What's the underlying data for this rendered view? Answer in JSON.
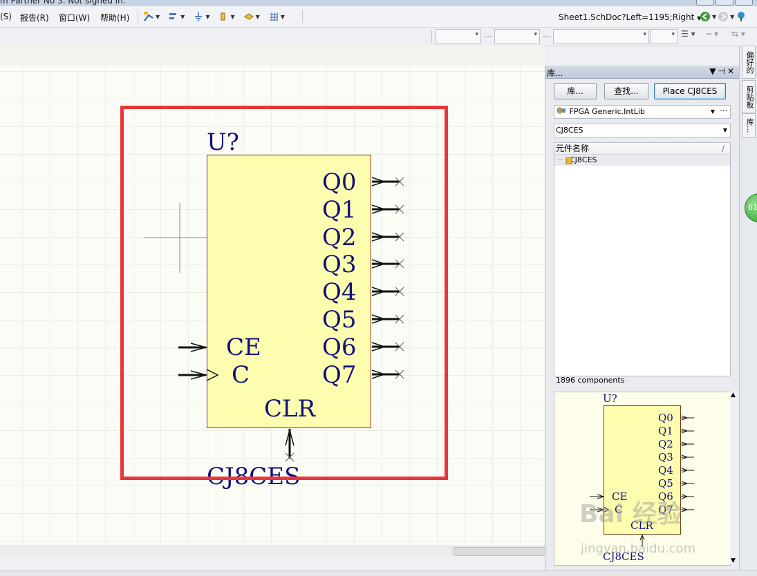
{
  "title_bar": {
    "text": "m Partner No 3. Not signed in."
  },
  "menu": {
    "items": [
      {
        "label": "(S)"
      },
      {
        "label": "报告(R)"
      },
      {
        "label": "窗口(W)"
      },
      {
        "label": "帮助(H)"
      }
    ]
  },
  "toolbar": {
    "document_path": "Sheet1.SchDoc?Left=1195;Right"
  },
  "schematic": {
    "designator": "U?",
    "part_name": "CJ8CES",
    "outputs": [
      "Q0",
      "Q1",
      "Q2",
      "Q3",
      "Q4",
      "Q5",
      "Q6",
      "Q7"
    ],
    "inputs": [
      "CE",
      "C"
    ],
    "bottom_pin": "CLR"
  },
  "library_panel": {
    "title": "库...",
    "buttons": {
      "libraries": "库...",
      "search": "查找...",
      "place": "Place CJ8CES"
    },
    "library_selected": "FPGA Generic.IntLib",
    "filter_value": "CJ8CES",
    "list_header": "元件名称",
    "list_items": [
      "CJ8CES"
    ],
    "component_count": "1896 components"
  },
  "right_tabs": [
    "偏好的",
    "剪贴板",
    "库..."
  ],
  "badge_text": "61",
  "watermark": {
    "main": "Bai 经验",
    "sub": "jingyan.baidu.com"
  }
}
